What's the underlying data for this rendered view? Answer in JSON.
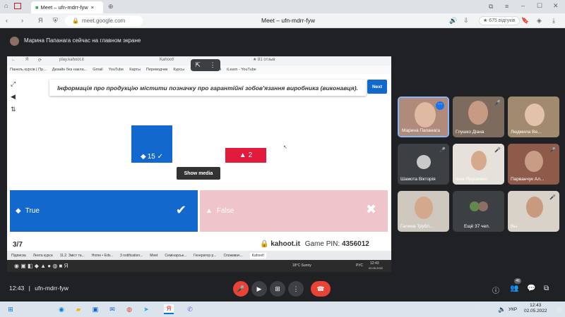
{
  "outer_browser": {
    "tabs": [
      {
        "label": "Meet – ufn-mdrr-fyw",
        "active": true
      }
    ],
    "toolbar": {
      "url": "meet.google.com",
      "title": "Meet – ufn-mdrr-fyw",
      "reviews": "★ 675 відгуків"
    }
  },
  "banner": {
    "text": "Марина Папанага сейчас на главном экране"
  },
  "shared_screen": {
    "inner_toolbar": {
      "url": "play.kahoot.it",
      "title": "Kahoot!",
      "reviews": "★ 81 отзыв"
    },
    "bookmarks": [
      "Панель курсів | Пр...",
      "Дизайн без накла...",
      "Gmail",
      "YouTube",
      "Карты",
      "Переводчик",
      "Курсы",
      "Телеграм онлайн",
      "iLearn - YouTube"
    ],
    "question": "Інформація про продукцію містити позначку про гарантійні зобов'язання виробника (виконавця).",
    "next_label": "Next",
    "results": [
      {
        "label": "15 ✓",
        "count": 15,
        "color": "#1368ce"
      },
      {
        "label": "2",
        "count": 2,
        "color": "#e21b3c"
      }
    ],
    "show_media_label": "Show media",
    "answers": [
      {
        "label": "True",
        "symbol": "◆",
        "mark": "✔",
        "color": "#1368ce"
      },
      {
        "label": "False",
        "symbol": "▲",
        "mark": "✖",
        "color": "#f0c4cb"
      }
    ],
    "footer": {
      "progress": "3/7",
      "site": "kahoot.it",
      "pin_label": "Game PIN:",
      "pin": "4356012"
    },
    "inner_tabs": [
      "Підписка",
      "Лента курса",
      "11.2. Зміст та...",
      "Home • Edv...",
      "3 notification...",
      "Meet",
      "Семінарськ...",
      "Генератор р...",
      "Споживач...",
      "Kahoot!"
    ],
    "inner_tray": {
      "temp": "18°C Sunny",
      "lang": "РУС",
      "time": "12:43",
      "date": "02.05.2022"
    }
  },
  "participants": [
    {
      "name": "Марина Папанага",
      "mic": "⋯"
    },
    {
      "name": "Глушко Діана",
      "mic": "🎤"
    },
    {
      "name": "Людмила Ве...",
      "mic": ""
    },
    {
      "name": "Шамота Вікторія",
      "mic": "🎤"
    },
    {
      "name": "Інна Ярушенко",
      "mic": "🎤"
    },
    {
      "name": "Парванчук Ал...",
      "mic": "🎤"
    },
    {
      "name": "Галина Трубл...",
      "mic": ""
    },
    {
      "name": "Ещё 37 чел.",
      "mic": ""
    },
    {
      "name": "Вы",
      "mic": "🎤"
    }
  ],
  "controls": {
    "meeting_code": "ufn-mdrr-fyw",
    "time": "12:43",
    "participants_badge": "46"
  },
  "taskbar": {
    "time": "12:43",
    "date": "02.05.2022",
    "lang": "УКР"
  },
  "colors": {
    "kahoot_blue": "#1368ce",
    "kahoot_red": "#e21b3c",
    "meet_red": "#ea4335",
    "meet_bg": "#202124"
  }
}
